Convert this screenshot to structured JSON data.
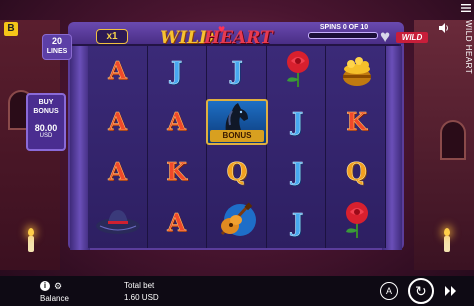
{
  "header": {
    "brand_badge": "B",
    "vertical_title": "WILD HEART",
    "lines_count": "20",
    "lines_label": "LINES",
    "multiplier": "x1",
    "logo_wild": "WILD",
    "logo_heart": "HEART",
    "spins_label": "SPINS 0 OF 10",
    "spins_progress": 0.0,
    "wild_badge": "WILD"
  },
  "buy_bonus": {
    "title_line1": "BUY",
    "title_line2": "BONUS",
    "price": "80.00",
    "currency": "USD"
  },
  "reels": {
    "rows": [
      [
        "A",
        "J",
        "J",
        "rose",
        "gold-pot"
      ],
      [
        "A",
        "A",
        "bonus-horse",
        "J",
        "K"
      ],
      [
        "A",
        "K",
        "Q",
        "J",
        "Q"
      ],
      [
        "hat",
        "A",
        "guitar",
        "J",
        "rose"
      ]
    ],
    "bonus_label": "BONUS"
  },
  "bottom_bar": {
    "balance_label": "Balance",
    "total_bet_label": "Total bet",
    "total_bet_value": "1.60 USD",
    "auto_label": "A"
  },
  "colors": {
    "frame": "#5b3d9b",
    "reel_bg": "#2d1f62",
    "accent_gold": "#f6c232",
    "accent_red": "#e83a50"
  }
}
